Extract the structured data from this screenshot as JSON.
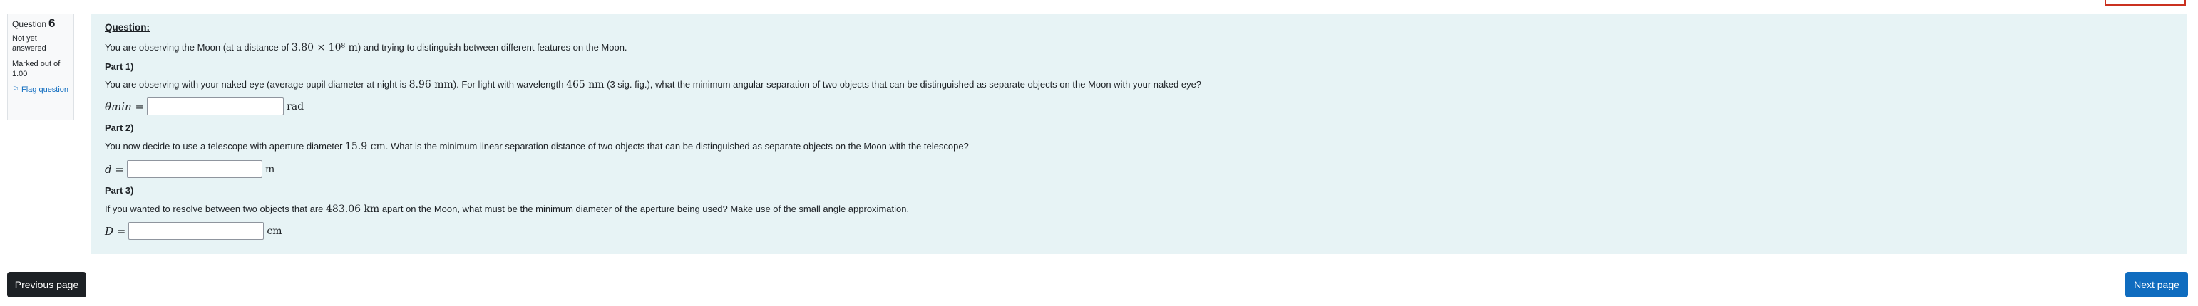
{
  "info": {
    "question_label": "Question",
    "question_number": "6",
    "state": "Not yet answered",
    "grade": "Marked out of 1.00",
    "flag_label": "Flag question"
  },
  "question": {
    "heading": "Question:",
    "intro_before": "You are observing the Moon (at a distance of ",
    "intro_math": "3.80 × 10⁸ m",
    "intro_after": ") and trying to distinguish between different features on the Moon.",
    "part1_title": "Part 1)",
    "part1_text_a": "You are observing with your naked eye (average pupil diameter at night is ",
    "part1_math_a": "8.96 mm",
    "part1_text_b": "). For light with wavelength ",
    "part1_math_b": "465 nm",
    "part1_text_c": " (3 sig. fig.), what the minimum angular separation of two objects that can be distinguished as separate objects on the Moon with your naked eye?",
    "part1_label": "θmin =",
    "part1_unit": "rad",
    "part2_title": "Part 2)",
    "part2_text_a": "You now decide to use a telescope with aperture diameter ",
    "part2_math": "15.9 cm",
    "part2_text_b": ". What is the minimum linear separation distance of two objects that can be distinguished as separate objects on the Moon with the telescope?",
    "part2_label": "d =",
    "part2_unit": "m",
    "part3_title": "Part 3)",
    "part3_text_a": "If you wanted to resolve between two objects that are ",
    "part3_math": "483.06 km",
    "part3_text_b": " apart on the Moon, what must be the minimum diameter of the aperture being used? Make use of the small angle approximation.",
    "part3_label": "D =",
    "part3_unit": "cm"
  },
  "nav": {
    "previous_label": "Previous page",
    "next_label": "Next page"
  },
  "colors": {
    "content_bg": "#e7f3f5",
    "primary": "#0f6cbf",
    "dark_button": "#1d2125",
    "flag_red": "#ca3120"
  }
}
